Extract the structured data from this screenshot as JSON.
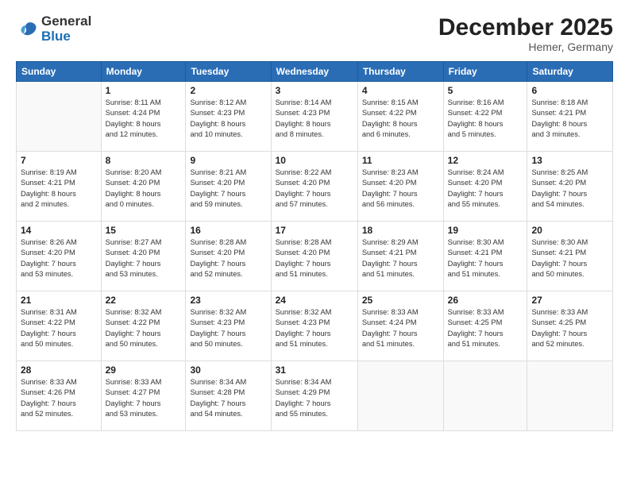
{
  "logo": {
    "general": "General",
    "blue": "Blue"
  },
  "title": "December 2025",
  "location": "Hemer, Germany",
  "days_header": [
    "Sunday",
    "Monday",
    "Tuesday",
    "Wednesday",
    "Thursday",
    "Friday",
    "Saturday"
  ],
  "weeks": [
    [
      {
        "day": "",
        "info": ""
      },
      {
        "day": "1",
        "info": "Sunrise: 8:11 AM\nSunset: 4:24 PM\nDaylight: 8 hours\nand 12 minutes."
      },
      {
        "day": "2",
        "info": "Sunrise: 8:12 AM\nSunset: 4:23 PM\nDaylight: 8 hours\nand 10 minutes."
      },
      {
        "day": "3",
        "info": "Sunrise: 8:14 AM\nSunset: 4:23 PM\nDaylight: 8 hours\nand 8 minutes."
      },
      {
        "day": "4",
        "info": "Sunrise: 8:15 AM\nSunset: 4:22 PM\nDaylight: 8 hours\nand 6 minutes."
      },
      {
        "day": "5",
        "info": "Sunrise: 8:16 AM\nSunset: 4:22 PM\nDaylight: 8 hours\nand 5 minutes."
      },
      {
        "day": "6",
        "info": "Sunrise: 8:18 AM\nSunset: 4:21 PM\nDaylight: 8 hours\nand 3 minutes."
      }
    ],
    [
      {
        "day": "7",
        "info": "Sunrise: 8:19 AM\nSunset: 4:21 PM\nDaylight: 8 hours\nand 2 minutes."
      },
      {
        "day": "8",
        "info": "Sunrise: 8:20 AM\nSunset: 4:20 PM\nDaylight: 8 hours\nand 0 minutes."
      },
      {
        "day": "9",
        "info": "Sunrise: 8:21 AM\nSunset: 4:20 PM\nDaylight: 7 hours\nand 59 minutes."
      },
      {
        "day": "10",
        "info": "Sunrise: 8:22 AM\nSunset: 4:20 PM\nDaylight: 7 hours\nand 57 minutes."
      },
      {
        "day": "11",
        "info": "Sunrise: 8:23 AM\nSunset: 4:20 PM\nDaylight: 7 hours\nand 56 minutes."
      },
      {
        "day": "12",
        "info": "Sunrise: 8:24 AM\nSunset: 4:20 PM\nDaylight: 7 hours\nand 55 minutes."
      },
      {
        "day": "13",
        "info": "Sunrise: 8:25 AM\nSunset: 4:20 PM\nDaylight: 7 hours\nand 54 minutes."
      }
    ],
    [
      {
        "day": "14",
        "info": "Sunrise: 8:26 AM\nSunset: 4:20 PM\nDaylight: 7 hours\nand 53 minutes."
      },
      {
        "day": "15",
        "info": "Sunrise: 8:27 AM\nSunset: 4:20 PM\nDaylight: 7 hours\nand 53 minutes."
      },
      {
        "day": "16",
        "info": "Sunrise: 8:28 AM\nSunset: 4:20 PM\nDaylight: 7 hours\nand 52 minutes."
      },
      {
        "day": "17",
        "info": "Sunrise: 8:28 AM\nSunset: 4:20 PM\nDaylight: 7 hours\nand 51 minutes."
      },
      {
        "day": "18",
        "info": "Sunrise: 8:29 AM\nSunset: 4:21 PM\nDaylight: 7 hours\nand 51 minutes."
      },
      {
        "day": "19",
        "info": "Sunrise: 8:30 AM\nSunset: 4:21 PM\nDaylight: 7 hours\nand 51 minutes."
      },
      {
        "day": "20",
        "info": "Sunrise: 8:30 AM\nSunset: 4:21 PM\nDaylight: 7 hours\nand 50 minutes."
      }
    ],
    [
      {
        "day": "21",
        "info": "Sunrise: 8:31 AM\nSunset: 4:22 PM\nDaylight: 7 hours\nand 50 minutes."
      },
      {
        "day": "22",
        "info": "Sunrise: 8:32 AM\nSunset: 4:22 PM\nDaylight: 7 hours\nand 50 minutes."
      },
      {
        "day": "23",
        "info": "Sunrise: 8:32 AM\nSunset: 4:23 PM\nDaylight: 7 hours\nand 50 minutes."
      },
      {
        "day": "24",
        "info": "Sunrise: 8:32 AM\nSunset: 4:23 PM\nDaylight: 7 hours\nand 51 minutes."
      },
      {
        "day": "25",
        "info": "Sunrise: 8:33 AM\nSunset: 4:24 PM\nDaylight: 7 hours\nand 51 minutes."
      },
      {
        "day": "26",
        "info": "Sunrise: 8:33 AM\nSunset: 4:25 PM\nDaylight: 7 hours\nand 51 minutes."
      },
      {
        "day": "27",
        "info": "Sunrise: 8:33 AM\nSunset: 4:25 PM\nDaylight: 7 hours\nand 52 minutes."
      }
    ],
    [
      {
        "day": "28",
        "info": "Sunrise: 8:33 AM\nSunset: 4:26 PM\nDaylight: 7 hours\nand 52 minutes."
      },
      {
        "day": "29",
        "info": "Sunrise: 8:33 AM\nSunset: 4:27 PM\nDaylight: 7 hours\nand 53 minutes."
      },
      {
        "day": "30",
        "info": "Sunrise: 8:34 AM\nSunset: 4:28 PM\nDaylight: 7 hours\nand 54 minutes."
      },
      {
        "day": "31",
        "info": "Sunrise: 8:34 AM\nSunset: 4:29 PM\nDaylight: 7 hours\nand 55 minutes."
      },
      {
        "day": "",
        "info": ""
      },
      {
        "day": "",
        "info": ""
      },
      {
        "day": "",
        "info": ""
      }
    ]
  ]
}
